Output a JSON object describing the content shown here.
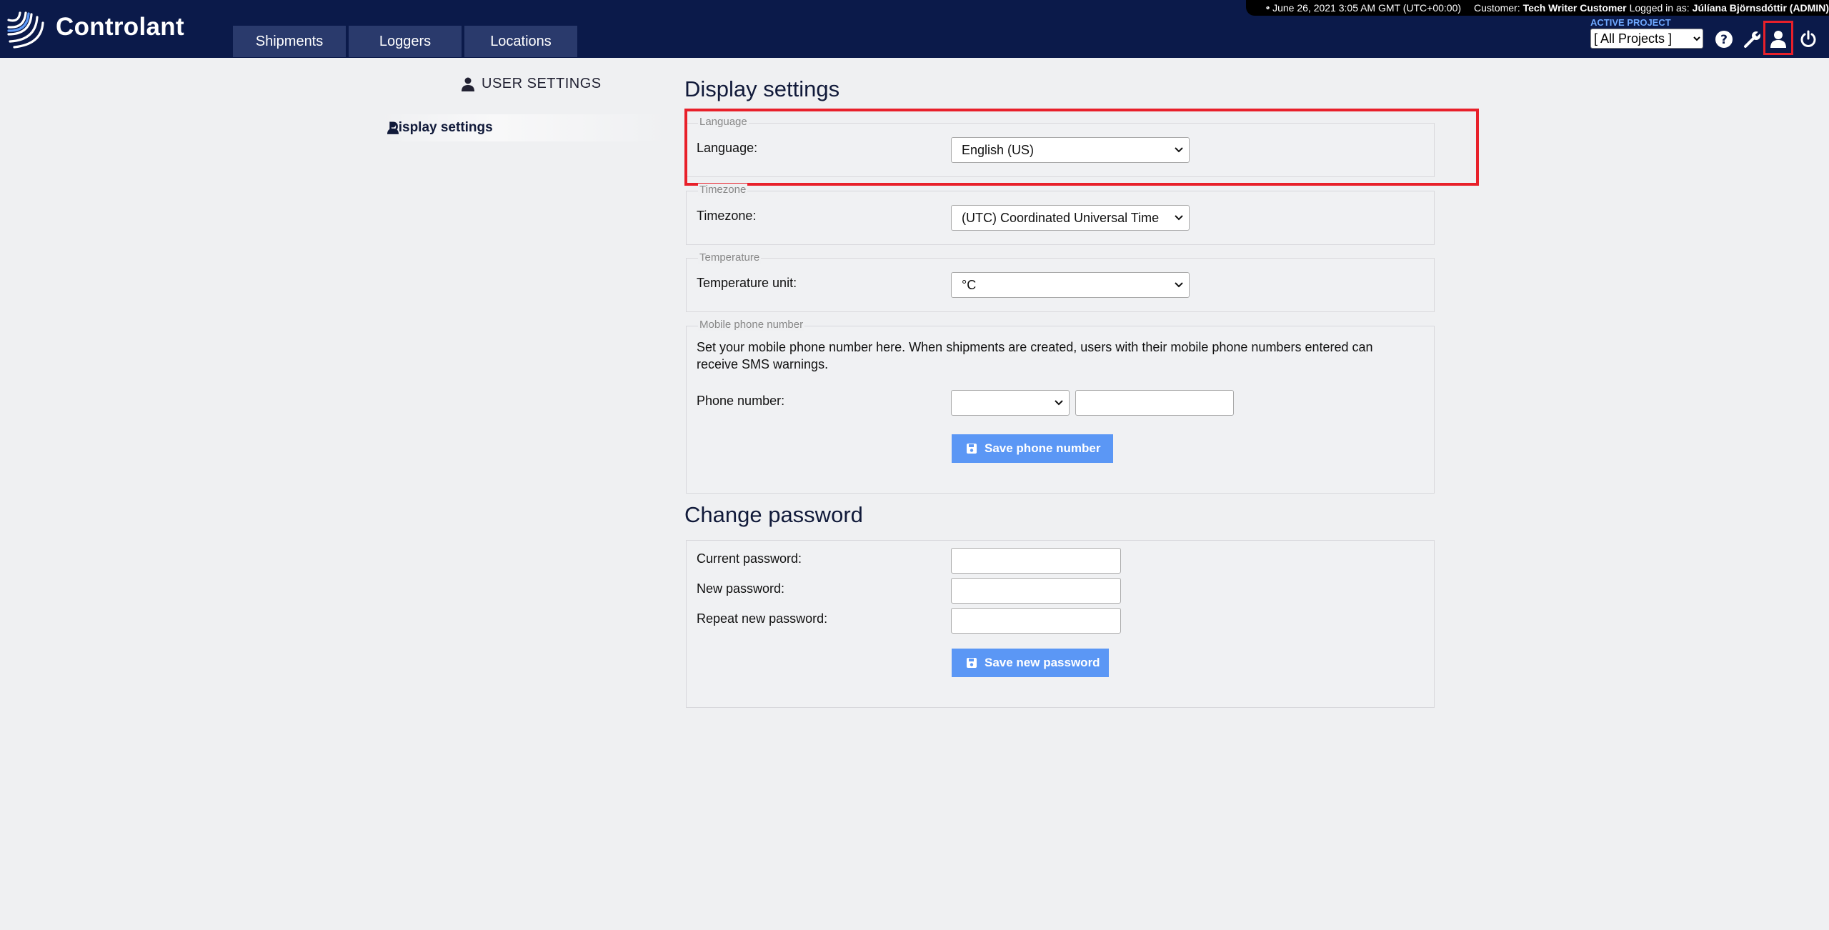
{
  "app": {
    "brand": "Controlant",
    "nav_tabs": [
      {
        "label": "Shipments"
      },
      {
        "label": "Loggers"
      },
      {
        "label": "Locations"
      }
    ]
  },
  "infobar": {
    "datetime": "June 26, 2021 3:05 AM GMT (UTC+00:00)",
    "customer_label": "Customer:",
    "customer_name": "Tech Writer Customer",
    "logged_in_label": "Logged in as:",
    "user_name": "Júlíana Björnsdóttir (ADMIN)"
  },
  "project": {
    "active_label": "ACTIVE PROJECT",
    "selected": "[ All Projects ]"
  },
  "header_icons": [
    "help-icon",
    "wrench-icon",
    "user-icon",
    "power-icon"
  ],
  "sidebar": {
    "title": "USER SETTINGS",
    "items": [
      {
        "label": "Display settings"
      }
    ]
  },
  "display_settings": {
    "title": "Display settings",
    "language": {
      "legend": "Language",
      "label": "Language:",
      "value": "English (US)"
    },
    "timezone": {
      "legend": "Timezone",
      "label": "Timezone:",
      "value": "(UTC) Coordinated Universal Time"
    },
    "temperature": {
      "legend": "Temperature",
      "label": "Temperature unit:",
      "value": "°C"
    },
    "mobile": {
      "legend": "Mobile phone number",
      "description": "Set your mobile phone number here. When shipments are created, users with their mobile phone numbers entered can receive SMS warnings.",
      "label": "Phone number:",
      "country_code": "",
      "number": "",
      "save_label": "Save phone number"
    }
  },
  "change_password": {
    "title": "Change password",
    "current_label": "Current password:",
    "new_label": "New password:",
    "repeat_label": "Repeat new password:",
    "save_label": "Save new password"
  },
  "colors": {
    "topbar": "#0b1a4a",
    "tab": "#2a3a6c",
    "button": "#5b97f5",
    "highlight": "#e8202a",
    "active_project": "#6ea8ff"
  }
}
